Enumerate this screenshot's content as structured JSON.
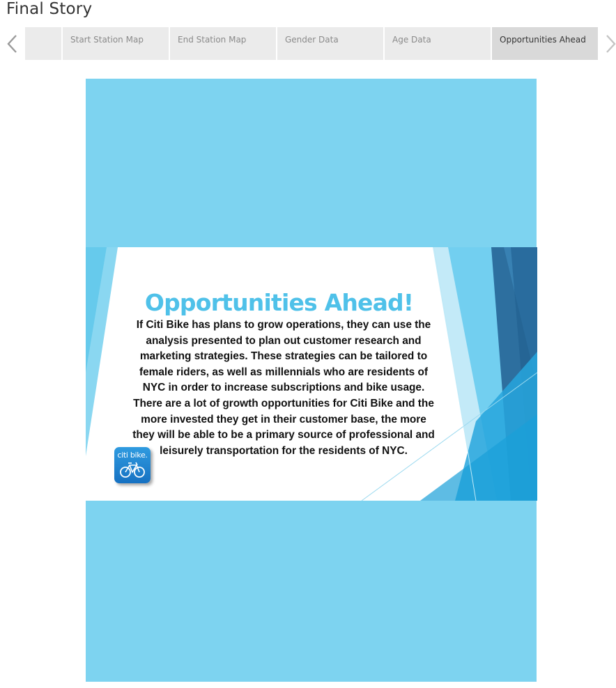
{
  "story": {
    "title": "Final Story"
  },
  "nav": {
    "prev_icon": "chevron-left-icon",
    "next_icon": "chevron-right-icon"
  },
  "tabs": [
    {
      "label": ""
    },
    {
      "label": "Start Station Map"
    },
    {
      "label": "End Station Map"
    },
    {
      "label": "Gender Data"
    },
    {
      "label": "Age Data"
    },
    {
      "label": "Opportunities Ahead",
      "active": true
    }
  ],
  "slide": {
    "title": "Opportunities Ahead!",
    "body": "If Citi Bike has plans to grow operations, they can use the analysis presented to plan out customer research and marketing strategies. These strategies can be tailored to female riders, as well as millennials who are residents of NYC in order to increase subscriptions and bike usage. There are a lot of growth opportunities for Citi Bike and the more invested they get in their customer base, the more they will be able to be a primary source of professional and leisurely transportation for the residents of NYC.",
    "logo_text": "citi bike.",
    "logo_icon": "bicycle-icon"
  },
  "colors": {
    "panel_bg": "#7dd3f0",
    "title_blue": "#4fc1e9",
    "tab_bg": "#ebebeb",
    "tab_active_bg": "#d9d9d9",
    "logo_blue": "#1d7fd1"
  }
}
